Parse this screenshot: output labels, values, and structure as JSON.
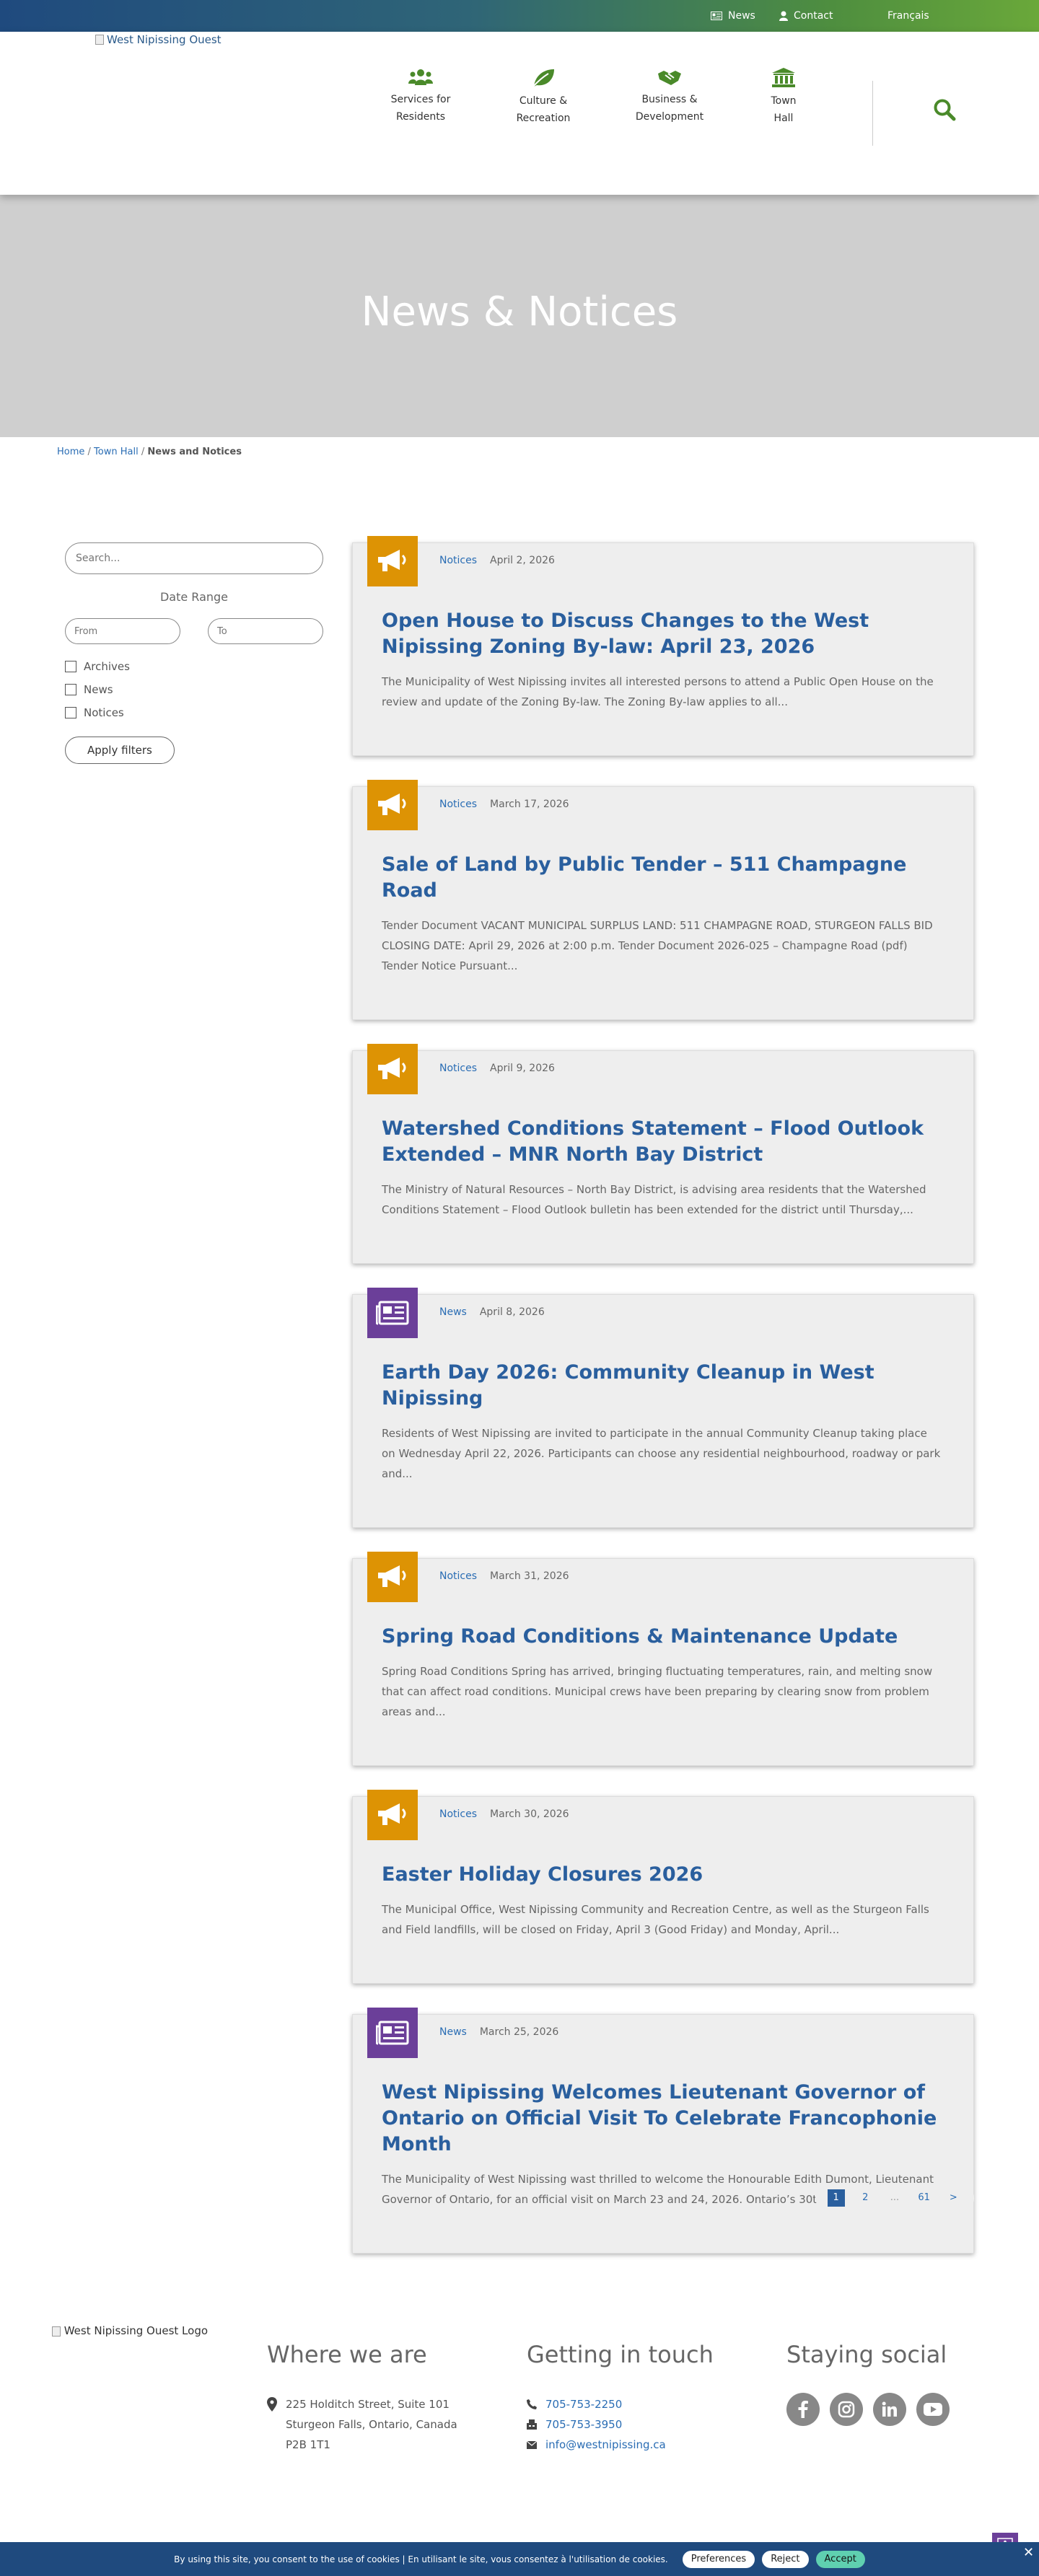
{
  "topbar": {
    "news": "News",
    "contact": "Contact",
    "language": "Français"
  },
  "header": {
    "logo_alt": "West Nipissing Ouest",
    "nav": [
      {
        "line1": "Services for",
        "line2": "Residents",
        "icon": "people-icon"
      },
      {
        "line1": "Culture &",
        "line2": "Recreation",
        "icon": "leaf-icon"
      },
      {
        "line1": "Business &",
        "line2": "Development",
        "icon": "handshake-icon"
      },
      {
        "line1": "Town",
        "line2": "Hall",
        "icon": "town-hall-icon"
      }
    ],
    "search_icon": "search-icon"
  },
  "hero": {
    "title": "News & Notices"
  },
  "breadcrumb": {
    "home": "Home",
    "sep1": " / ",
    "town_hall": "Town Hall",
    "sep2": " / ",
    "current": "News and Notices"
  },
  "sidebar": {
    "search_placeholder": "Search...",
    "date_range_label": "Date Range",
    "from_placeholder": "From",
    "to_placeholder": "To",
    "filters": [
      "Archives",
      "News",
      "Notices"
    ],
    "apply_label": "Apply filters"
  },
  "cards": [
    {
      "category": "Notices",
      "date": "April 2, 2026",
      "title": "Open House to Discuss Changes to the West Nipissing Zoning By-law: April 23, 2026",
      "excerpt": "The Municipality of West Nipissing invites all interested persons to attend a Public Open House on the review and update of the Zoning By-law. The Zoning By-law applies to all..."
    },
    {
      "category": "Notices",
      "date": "March 17, 2026",
      "title": "Sale of Land by Public Tender – 511 Champagne Road",
      "excerpt": "Tender Document VACANT MUNICIPAL SURPLUS LAND: 511 CHAMPAGNE ROAD, STURGEON FALLS BID CLOSING DATE: April 29, 2026 at 2:00 p.m. Tender Document 2026-025 – Champagne Road (pdf) Tender Notice Pursuant..."
    },
    {
      "category": "Notices",
      "date": "April 9, 2026",
      "title": "Watershed Conditions Statement – Flood Outlook Extended – MNR North Bay District",
      "excerpt": "The Ministry of Natural Resources – North Bay District, is advising area residents that the Watershed Conditions Statement – Flood Outlook bulletin has been extended for the district until Thursday,..."
    },
    {
      "category": "News",
      "date": "April 8, 2026",
      "title": "Earth Day 2026: Community Cleanup in West Nipissing",
      "excerpt": "Residents of West Nipissing are invited to participate in the annual Community Cleanup taking place on Wednesday April 22, 2026. Participants can choose any residential neighbourhood, roadway or park and..."
    },
    {
      "category": "Notices",
      "date": "March 31, 2026",
      "title": "Spring Road Conditions & Maintenance Update",
      "excerpt": "Spring Road Conditions Spring has arrived, bringing fluctuating temperatures, rain, and melting snow that can affect road conditions. Municipal crews have been preparing by clearing snow from problem areas and..."
    },
    {
      "category": "Notices",
      "date": "March 30, 2026",
      "title": "Easter Holiday Closures 2026",
      "excerpt": "The Municipal Office, West Nipissing Community and Recreation Centre, as well as the Sturgeon Falls and Field landfills, will be closed on Friday, April 3 (Good Friday) and Monday, April..."
    },
    {
      "category": "News",
      "date": "March 25, 2026",
      "title": "West Nipissing Welcomes Lieutenant Governor of Ontario on Official Visit To Celebrate Francophonie Month",
      "excerpt": "The Municipality of West Nipissing wast thrilled to welcome the Honourable Edith Dumont, Lieutenant Governor of Ontario, for an official visit on March 23 and 24, 2026. Ontario’s 30th Lieutenant..."
    }
  ],
  "pagination": {
    "current": "1",
    "next_page": "2",
    "dots": "...",
    "last": "61",
    "next": ">"
  },
  "footer": {
    "logo_alt": "West Nipissing Ouest Logo",
    "where_title": "Where we are",
    "address": [
      "225 Holditch Street, Suite 101",
      "Sturgeon Falls, Ontario, Canada",
      "P2B 1T1"
    ],
    "touch_title": "Getting in touch",
    "phone": "705-753-2250",
    "fax": "705-753-3950",
    "email": "info@westnipissing.ca",
    "social_title": "Staying social",
    "socials": [
      "facebook-icon",
      "instagram-icon",
      "linkedin-icon",
      "youtube-icon"
    ]
  },
  "cookie": {
    "text": "By using this site, you consent to the use of cookies  |  En utilisant le site, vous consentez à l'utilisation de cookies.",
    "preferences": "Preferences",
    "reject": "Reject",
    "accept": "Accept"
  },
  "colors": {
    "notices": "#dd9304",
    "news": "#6b3f99",
    "link": "#2a6db4",
    "title": "#2a5f9e",
    "green": "#4a8a2a"
  }
}
